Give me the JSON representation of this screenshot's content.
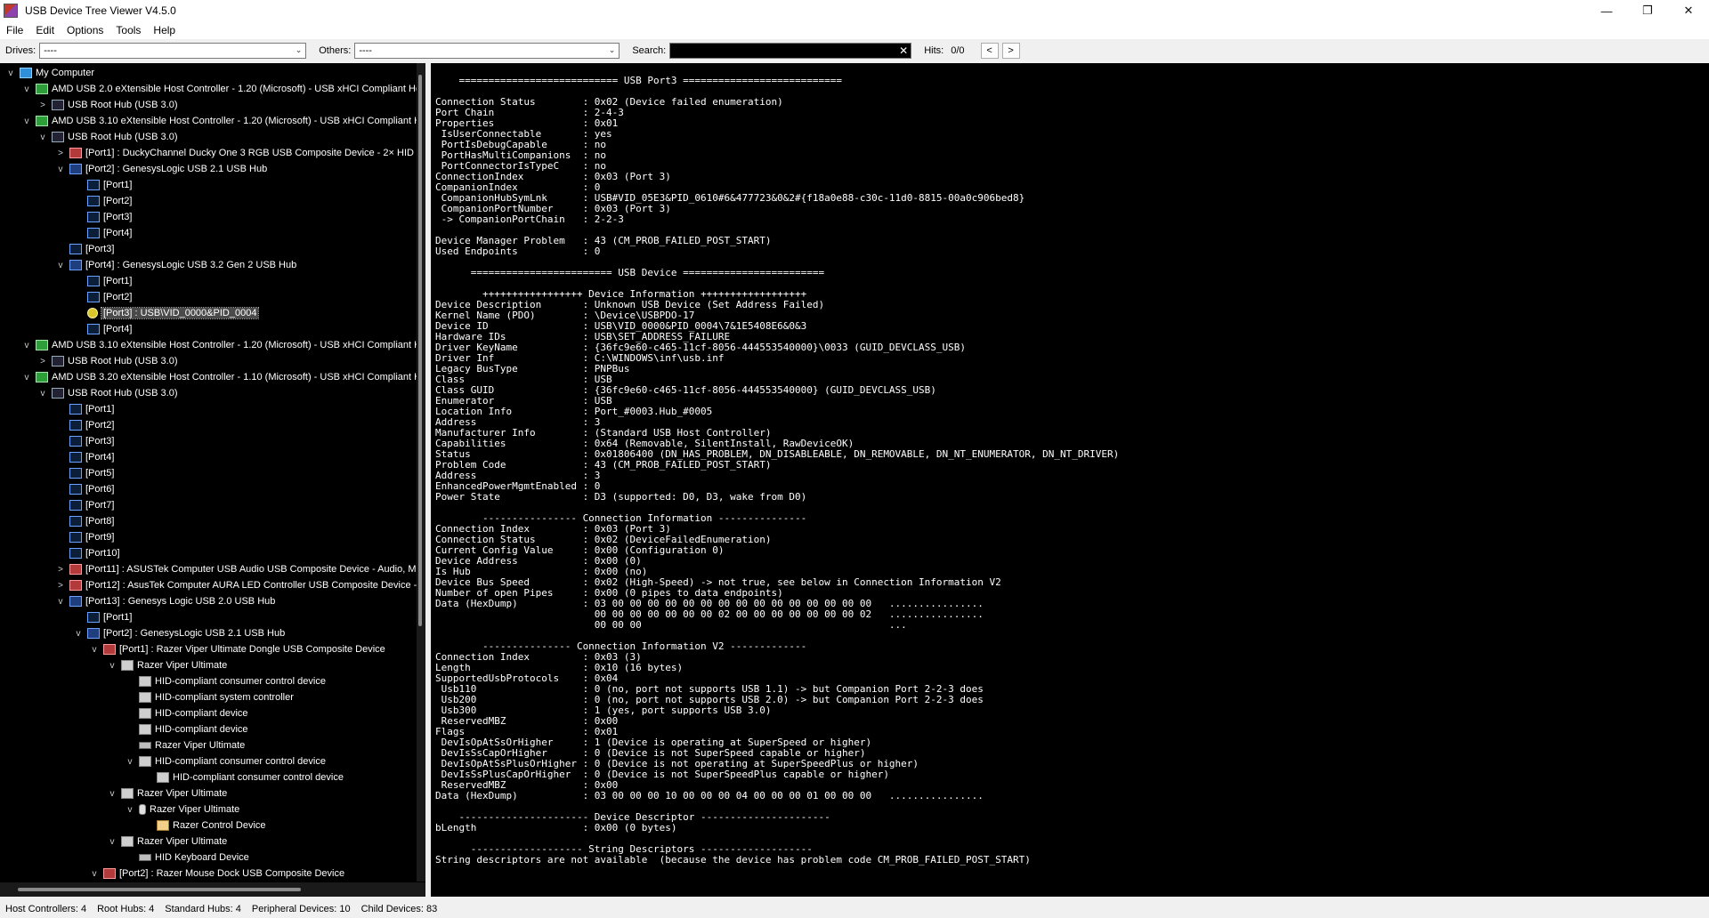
{
  "window": {
    "title": "USB Device Tree Viewer V4.5.0"
  },
  "menu": [
    "File",
    "Edit",
    "Options",
    "Tools",
    "Help"
  ],
  "toolbar": {
    "drives_label": "Drives:",
    "drives_value": "----",
    "others_label": "Others:",
    "others_value": "----",
    "search_label": "Search:",
    "search_value": "",
    "hits_label": "Hits:",
    "hits_value": "0/0",
    "prev": "<",
    "next": ">"
  },
  "tree": [
    {
      "label": "My Computer",
      "icon": "computer-icon",
      "exp": "v"
    },
    {
      "label": "AMD USB 2.0 eXtensible Host Controller - 1.20 (Microsoft) - USB xHCI Compliant Ho:",
      "icon": "host-controller-icon",
      "exp": "v"
    },
    {
      "label": "USB Root Hub (USB 3.0)",
      "icon": "root-hub-icon",
      "exp": ">"
    },
    {
      "label": "AMD USB 3.10 eXtensible Host Controller - 1.20 (Microsoft) - USB xHCI Compliant H",
      "icon": "host-controller-icon",
      "exp": "v"
    },
    {
      "label": "USB Root Hub (USB 3.0)",
      "icon": "root-hub-icon",
      "exp": "v"
    },
    {
      "label": "[Port1] : DuckyChannel Ducky One 3 RGB USB Composite Device - 2× HID",
      "icon": "composite-device-icon",
      "exp": ">"
    },
    {
      "label": "[Port2] : GenesysLogic USB 2.1 USB Hub",
      "icon": "hub-icon",
      "exp": "v"
    },
    {
      "label": "[Port1]",
      "icon": "usb-port-icon",
      "exp": ""
    },
    {
      "label": "[Port2]",
      "icon": "usb-port-icon",
      "exp": ""
    },
    {
      "label": "[Port3]",
      "icon": "usb-port-icon",
      "exp": ""
    },
    {
      "label": "[Port4]",
      "icon": "usb-port-icon",
      "exp": ""
    },
    {
      "label": "[Port3]",
      "icon": "usb-port-icon",
      "exp": ""
    },
    {
      "label": "[Port4] : GenesysLogic USB 3.2 Gen 2 USB Hub",
      "icon": "hub-icon",
      "exp": "v"
    },
    {
      "label": "[Port1]",
      "icon": "usb-port-icon",
      "exp": ""
    },
    {
      "label": "[Port2]",
      "icon": "usb-port-icon",
      "exp": ""
    },
    {
      "label": "[Port3] : USB\\VID_0000&PID_0004",
      "icon": "error-device-icon",
      "exp": "",
      "selected": true
    },
    {
      "label": "[Port4]",
      "icon": "usb-port-icon",
      "exp": ""
    },
    {
      "label": "AMD USB 3.10 eXtensible Host Controller - 1.20 (Microsoft) - USB xHCI Compliant H",
      "icon": "host-controller-icon",
      "exp": "v"
    },
    {
      "label": "USB Root Hub (USB 3.0)",
      "icon": "root-hub-icon",
      "exp": ">"
    },
    {
      "label": "AMD USB 3.20 eXtensible Host Controller - 1.10 (Microsoft) - USB xHCI Compliant H",
      "icon": "host-controller-icon",
      "exp": "v"
    },
    {
      "label": "USB Root Hub (USB 3.0)",
      "icon": "root-hub-icon",
      "exp": "v"
    },
    {
      "label": "[Port1]",
      "icon": "usb-port-icon",
      "exp": ""
    },
    {
      "label": "[Port2]",
      "icon": "usb-port-icon",
      "exp": ""
    },
    {
      "label": "[Port3]",
      "icon": "usb-port-icon",
      "exp": ""
    },
    {
      "label": "[Port4]",
      "icon": "usb-port-icon",
      "exp": ""
    },
    {
      "label": "[Port5]",
      "icon": "usb-port-icon",
      "exp": ""
    },
    {
      "label": "[Port6]",
      "icon": "usb-port-icon",
      "exp": ""
    },
    {
      "label": "[Port7]",
      "icon": "usb-port-icon",
      "exp": ""
    },
    {
      "label": "[Port8]",
      "icon": "usb-port-icon",
      "exp": ""
    },
    {
      "label": "[Port9]",
      "icon": "usb-port-icon",
      "exp": ""
    },
    {
      "label": "[Port10]",
      "icon": "usb-port-icon",
      "exp": ""
    },
    {
      "label": "[Port11] : ASUSTek Computer USB Audio USB Composite Device - Audio, M",
      "icon": "composite-device-icon",
      "exp": ">"
    },
    {
      "label": "[Port12] : AsusTek Computer AURA LED Controller USB Composite Device -",
      "icon": "composite-device-icon",
      "exp": ">"
    },
    {
      "label": "[Port13] : Genesys Logic USB 2.0 USB Hub",
      "icon": "hub-icon",
      "exp": "v"
    },
    {
      "label": "[Port1]",
      "icon": "usb-port-icon",
      "exp": ""
    },
    {
      "label": "[Port2] : GenesysLogic USB 2.1 USB Hub",
      "icon": "hub-icon",
      "exp": "v"
    },
    {
      "label": "[Port1] : Razer Viper Ultimate Dongle USB Composite Device",
      "icon": "composite-device-icon",
      "exp": "v"
    },
    {
      "label": "Razer Viper Ultimate",
      "icon": "hid-device-icon",
      "exp": "v"
    },
    {
      "label": "HID-compliant consumer control device",
      "icon": "hid-device-icon",
      "exp": ""
    },
    {
      "label": "HID-compliant system controller",
      "icon": "hid-device-icon",
      "exp": ""
    },
    {
      "label": "HID-compliant device",
      "icon": "hid-device-icon",
      "exp": ""
    },
    {
      "label": "HID-compliant device",
      "icon": "hid-device-icon",
      "exp": ""
    },
    {
      "label": "Razer Viper Ultimate",
      "icon": "keyboard-icon",
      "exp": ""
    },
    {
      "label": "HID-compliant consumer control device",
      "icon": "hid-device-icon",
      "exp": "v"
    },
    {
      "label": "HID-compliant consumer control device",
      "icon": "hid-device-icon",
      "exp": ""
    },
    {
      "label": "Razer Viper Ultimate",
      "icon": "hid-device-icon",
      "exp": "v"
    },
    {
      "label": "Razer Viper Ultimate",
      "icon": "mouse-icon",
      "exp": "v"
    },
    {
      "label": "Razer Control Device",
      "icon": "razer-device-icon",
      "exp": ""
    },
    {
      "label": "Razer Viper Ultimate",
      "icon": "hid-device-icon",
      "exp": "v"
    },
    {
      "label": "HID Keyboard Device",
      "icon": "keyboard-icon",
      "exp": ""
    },
    {
      "label": "[Port2] : Razer Mouse Dock USB Composite Device",
      "icon": "composite-device-icon",
      "exp": "v"
    }
  ],
  "details_text": "    =========================== USB Port3 ===========================\n\nConnection Status        : 0x02 (Device failed enumeration)\nPort Chain               : 2-4-3\nProperties               : 0x01\n IsUserConnectable       : yes\n PortIsDebugCapable      : no\n PortHasMultiCompanions  : no\n PortConnectorIsTypeC    : no\nConnectionIndex          : 0x03 (Port 3)\nCompanionIndex           : 0\n CompanionHubSymLnk      : USB#VID_05E3&PID_0610#6&477723&0&2#{f18a0e88-c30c-11d0-8815-00a0c906bed8}\n CompanionPortNumber     : 0x03 (Port 3)\n -> CompanionPortChain   : 2-2-3\n\nDevice Manager Problem   : 43 (CM_PROB_FAILED_POST_START)\nUsed Endpoints           : 0\n\n      ======================== USB Device ========================\n\n        +++++++++++++++++ Device Information ++++++++++++++++++\nDevice Description       : Unknown USB Device (Set Address Failed)\nKernel Name (PDO)        : \\Device\\USBPDO-17\nDevice ID                : USB\\VID_0000&PID_0004\\7&1E5408E6&0&3\nHardware IDs             : USB\\SET_ADDRESS_FAILURE\nDriver KeyName           : {36fc9e60-c465-11cf-8056-444553540000}\\0033 (GUID_DEVCLASS_USB)\nDriver Inf               : C:\\WINDOWS\\inf\\usb.inf\nLegacy BusType           : PNPBus\nClass                    : USB\nClass GUID               : {36fc9e60-c465-11cf-8056-444553540000} (GUID_DEVCLASS_USB)\nEnumerator               : USB\nLocation Info            : Port_#0003.Hub_#0005\nAddress                  : 3\nManufacturer Info        : (Standard USB Host Controller)\nCapabilities             : 0x64 (Removable, SilentInstall, RawDeviceOK)\nStatus                   : 0x01806400 (DN_HAS_PROBLEM, DN_DISABLEABLE, DN_REMOVABLE, DN_NT_ENUMERATOR, DN_NT_DRIVER)\nProblem Code             : 43 (CM_PROB_FAILED_POST_START)\nAddress                  : 3\nEnhancedPowerMgmtEnabled : 0\nPower State              : D3 (supported: D0, D3, wake from D0)\n\n        ---------------- Connection Information ---------------\nConnection Index         : 0x03 (Port 3)\nConnection Status        : 0x02 (DeviceFailedEnumeration)\nCurrent Config Value     : 0x00 (Configuration 0)\nDevice Address           : 0x00 (0)\nIs Hub                   : 0x00 (no)\nDevice Bus Speed         : 0x02 (High-Speed) -> not true, see below in Connection Information V2\nNumber of open Pipes     : 0x00 (0 pipes to data endpoints)\nData (HexDump)           : 03 00 00 00 00 00 00 00 00 00 00 00 00 00 00 00   ................\n                           00 00 00 00 00 00 00 02 00 00 00 00 00 00 00 02   ................\n                           00 00 00                                          ...\n\n        --------------- Connection Information V2 -------------\nConnection Index         : 0x03 (3)\nLength                   : 0x10 (16 bytes)\nSupportedUsbProtocols    : 0x04\n Usb110                  : 0 (no, port not supports USB 1.1) -> but Companion Port 2-2-3 does\n Usb200                  : 0 (no, port not supports USB 2.0) -> but Companion Port 2-2-3 does\n Usb300                  : 1 (yes, port supports USB 3.0)\n ReservedMBZ             : 0x00\nFlags                    : 0x01\n DevIsOpAtSsOrHigher     : 1 (Device is operating at SuperSpeed or higher)\n DevIsSsCapOrHigher      : 0 (Device is not SuperSpeed capable or higher)\n DevIsOpAtSsPlusOrHigher : 0 (Device is not operating at SuperSpeedPlus or higher)\n DevIsSsPlusCapOrHigher  : 0 (Device is not SuperSpeedPlus capable or higher)\n ReservedMBZ             : 0x00\nData (HexDump)           : 03 00 00 00 10 00 00 00 04 00 00 00 01 00 00 00   ................\n\n    ---------------------- Device Descriptor ----------------------\nbLength                  : 0x00 (0 bytes)\n\n      ------------------- String Descriptors -------------------\nString descriptors are not available  (because the device has problem code CM_PROB_FAILED_POST_START)",
  "status": {
    "host_controllers": "Host Controllers: 4",
    "root_hubs": "Root Hubs: 4",
    "standard_hubs": "Standard Hubs: 4",
    "peripheral_devices": "Peripheral Devices: 10",
    "child_devices": "Child Devices: 83"
  }
}
